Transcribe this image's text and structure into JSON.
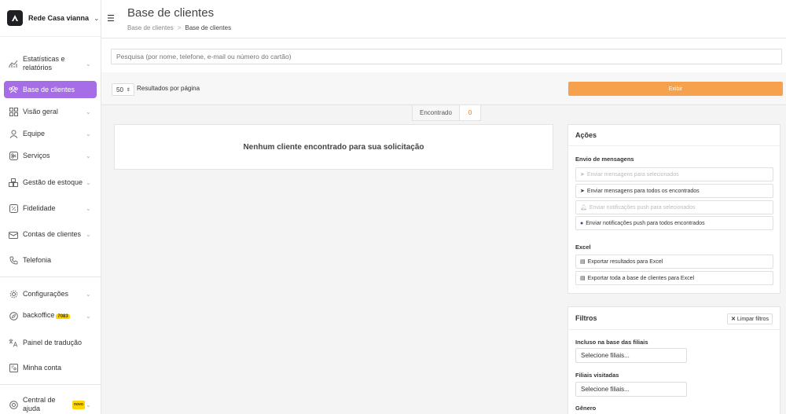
{
  "brand": {
    "name": "Rede Casa vianna",
    "icon": "chevron-down-icon"
  },
  "sidebar": {
    "items": [
      {
        "label": "Estatísticas e relatórios",
        "icon": "chart-icon",
        "chevron": true
      },
      {
        "label": "Base de clientes",
        "icon": "users-icon",
        "active": true
      },
      {
        "label": "Visão geral",
        "icon": "grid-icon",
        "chevron": true
      },
      {
        "label": "Equipe",
        "icon": "user-icon",
        "chevron": true
      },
      {
        "label": "Serviços",
        "icon": "scissors-icon",
        "chevron": true
      },
      {
        "label": "Gestão de estoque",
        "icon": "box-icon",
        "chevron": true
      },
      {
        "label": "Fidelidade",
        "icon": "percent-icon",
        "chevron": true
      },
      {
        "label": "Contas de clientes",
        "icon": "wallet-icon",
        "chevron": true
      },
      {
        "label": "Telefonia",
        "icon": "phone-icon"
      },
      {
        "label": "Configurações",
        "icon": "gear-icon",
        "chevron": true
      },
      {
        "label": "backoffice",
        "icon": "compass-icon",
        "badge": "7083",
        "chevron": true
      },
      {
        "label": "Painel de tradução",
        "icon": "translate-icon"
      },
      {
        "label": "Minha conta",
        "icon": "account-icon"
      },
      {
        "label": "Central de ajuda",
        "icon": "help-icon",
        "badge": "novo",
        "chevron": true
      }
    ]
  },
  "header": {
    "title": "Base de clientes",
    "breadcrumb": [
      "Base de clientes",
      "Base de clientes"
    ],
    "breadcrumb_sep": ">"
  },
  "search": {
    "placeholder": "Pesquisa (por nome, telefone, e-mail ou número do cartão)"
  },
  "results": {
    "per_page": "50",
    "per_page_label": "Resultados por página",
    "show_button": "Exibir",
    "found_label": "Encontrado",
    "found_count": "0",
    "empty_message": "Nenhum cliente encontrado para sua solicitação"
  },
  "actions": {
    "title": "Ações",
    "messaging_title": "Envio de mensagens",
    "buttons": [
      {
        "label": "Enviar mensagens para selecionados",
        "disabled": true,
        "icon": "send-icon"
      },
      {
        "label": "Enviar mensagens para todos os encontrados",
        "disabled": false,
        "icon": "send-icon"
      },
      {
        "label": "Enviar notificações push para selecionados",
        "disabled": true,
        "icon": "bell-icon"
      },
      {
        "label": "Enviar notificações push para todos encontrados",
        "disabled": false,
        "icon": "bell-icon"
      }
    ],
    "excel_title": "Excel",
    "excel_buttons": [
      {
        "label": "Exportar resultados para Excel",
        "icon": "file-icon"
      },
      {
        "label": "Exportar toda a base de clientes para Excel",
        "icon": "file-icon"
      }
    ]
  },
  "filters": {
    "title": "Filtros",
    "clear_label": "Limpar filtros",
    "branches_label": "Incluso na base das filiais",
    "branches_placeholder": "Selecione filiais...",
    "visited_label": "Filiais visitadas",
    "visited_placeholder": "Selecione filiais...",
    "gender_label": "Gênero"
  },
  "colors": {
    "accent": "#a66ee6",
    "orange": "#f5a14d",
    "count": "#f07a1a",
    "badge": "#ffd400"
  }
}
